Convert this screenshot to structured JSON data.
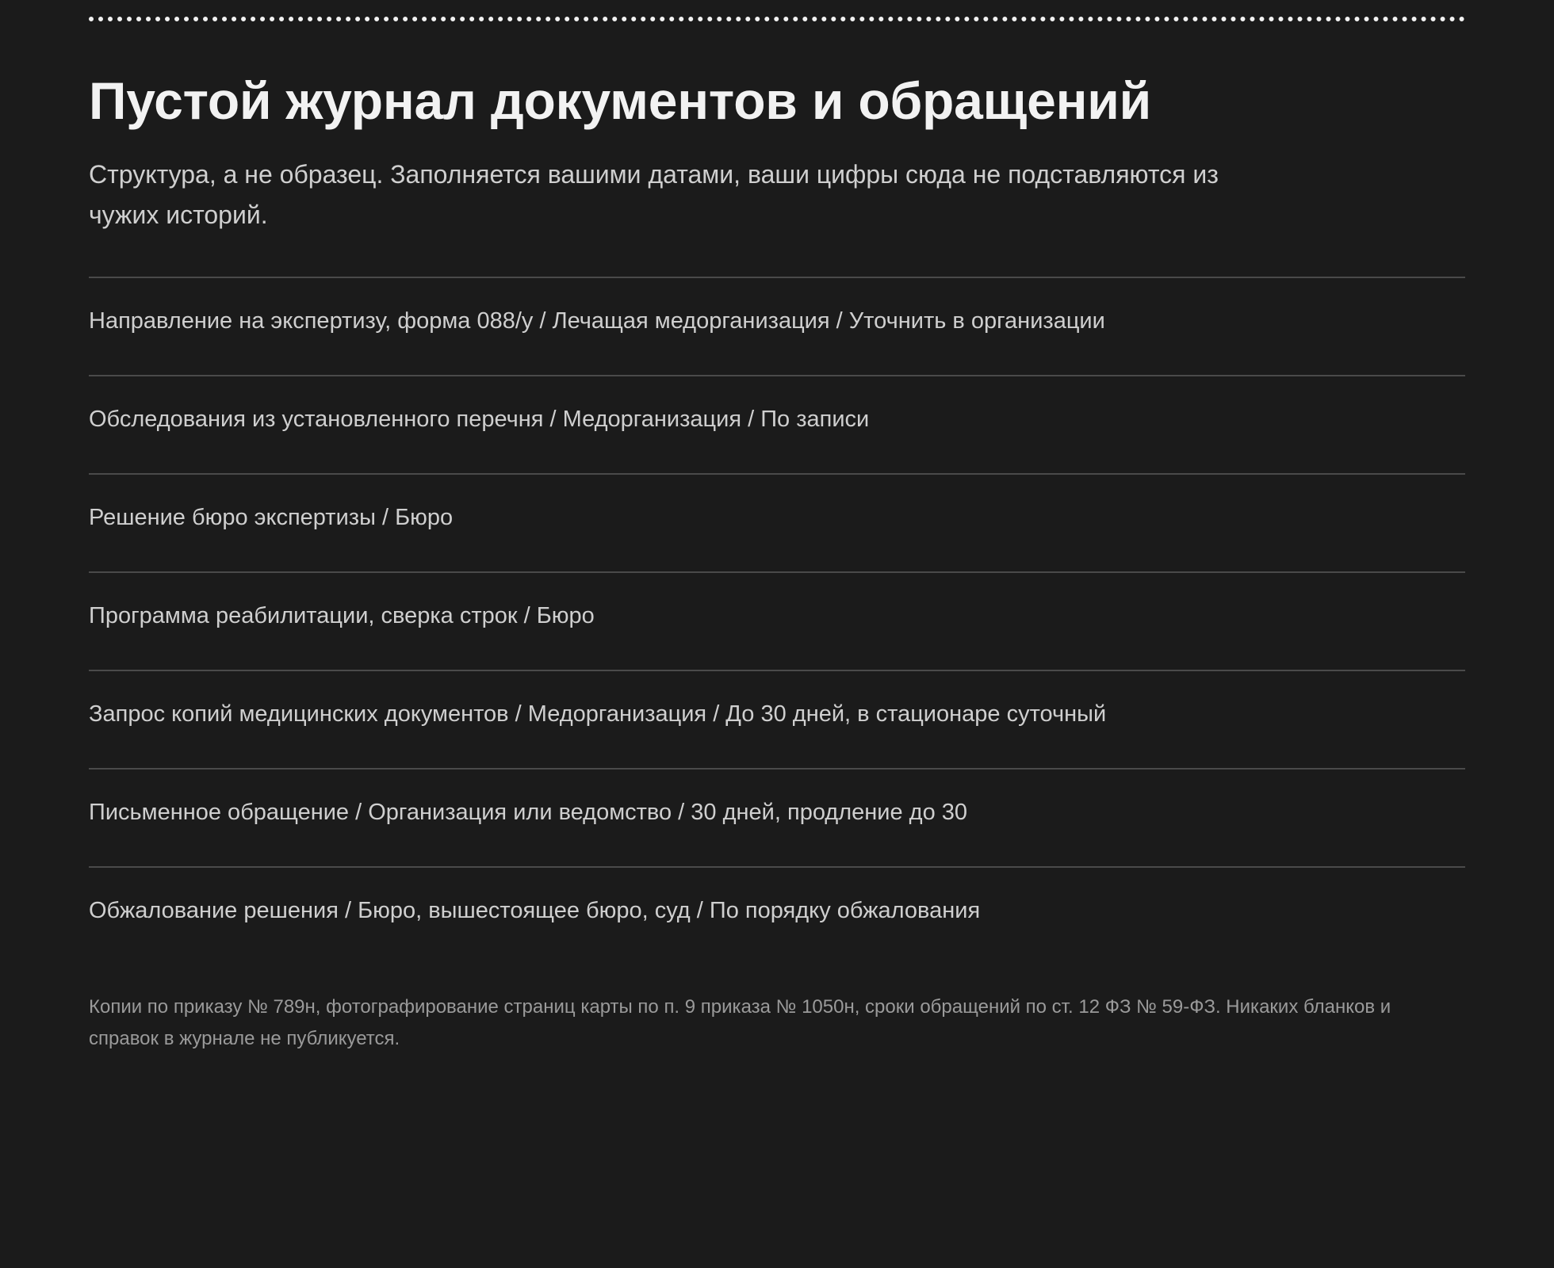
{
  "title": "Пустой журнал документов и обращений",
  "lead": "Структура, а не образец. Заполняется вашими датами, ваши цифры сюда не подставляются из чужих историй.",
  "rows": [
    "Направление на экспертизу, форма 088/у / Лечащая медорганизация / Уточнить в организации",
    "Обследования из установленного перечня / Медорганизация / По записи",
    "Решение бюро экспертизы / Бюро",
    "Программа реабилитации, сверка строк / Бюро",
    "Запрос копий медицинских документов / Медорганизация / До 30 дней, в стационаре суточный",
    "Письменное обращение / Организация или ведомство / 30 дней, продление до 30",
    "Обжалование решения / Бюро, вышестоящее бюро, суд / По порядку обжалования"
  ],
  "note": "Копии по приказу № 789н, фотографирование страниц карты по п. 9 приказа № 1050н, сроки обращений по ст. 12 ФЗ № 59-ФЗ. Никаких бланков и справок в журнале не публикуется."
}
